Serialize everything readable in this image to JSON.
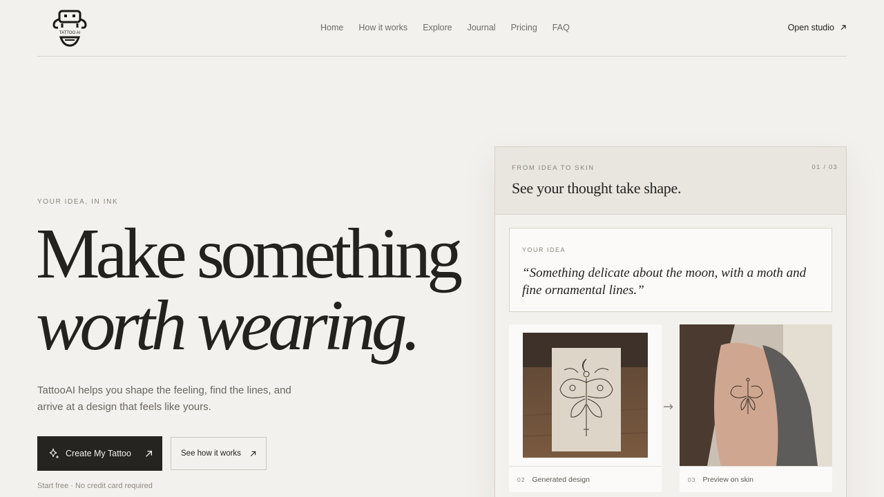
{
  "header": {
    "logo_text": "TATTOO AI",
    "nav": [
      "Home",
      "How it works",
      "Explore",
      "Journal",
      "Pricing",
      "FAQ"
    ],
    "cta": "Open studio"
  },
  "hero": {
    "eyebrow": "YOUR IDEA, IN INK",
    "title_line1": "Make something",
    "title_line2": "worth wearing.",
    "description": "TattooAI helps you shape the feeling, find the lines, and arrive at a design that feels like yours.",
    "primary_button": "Create My Tattoo",
    "secondary_button": "See how it works",
    "fine_print": "Start free · No credit card required"
  },
  "card": {
    "eyebrow": "FROM IDEA TO SKIN",
    "counter": "01 / 03",
    "title": "See your thought take shape.",
    "idea_label": "YOUR IDEA",
    "idea_text": "“Something delicate about the moon, with a moth and fine ornamental lines.”",
    "arrow": "→",
    "panels": [
      {
        "num": "02",
        "caption": "Generated design"
      },
      {
        "num": "03",
        "caption": "Preview on skin"
      }
    ]
  },
  "colors": {
    "background": "#f3f1ed",
    "ink": "#24221f",
    "muted": "#8a857d",
    "primary_button": "#262421"
  }
}
